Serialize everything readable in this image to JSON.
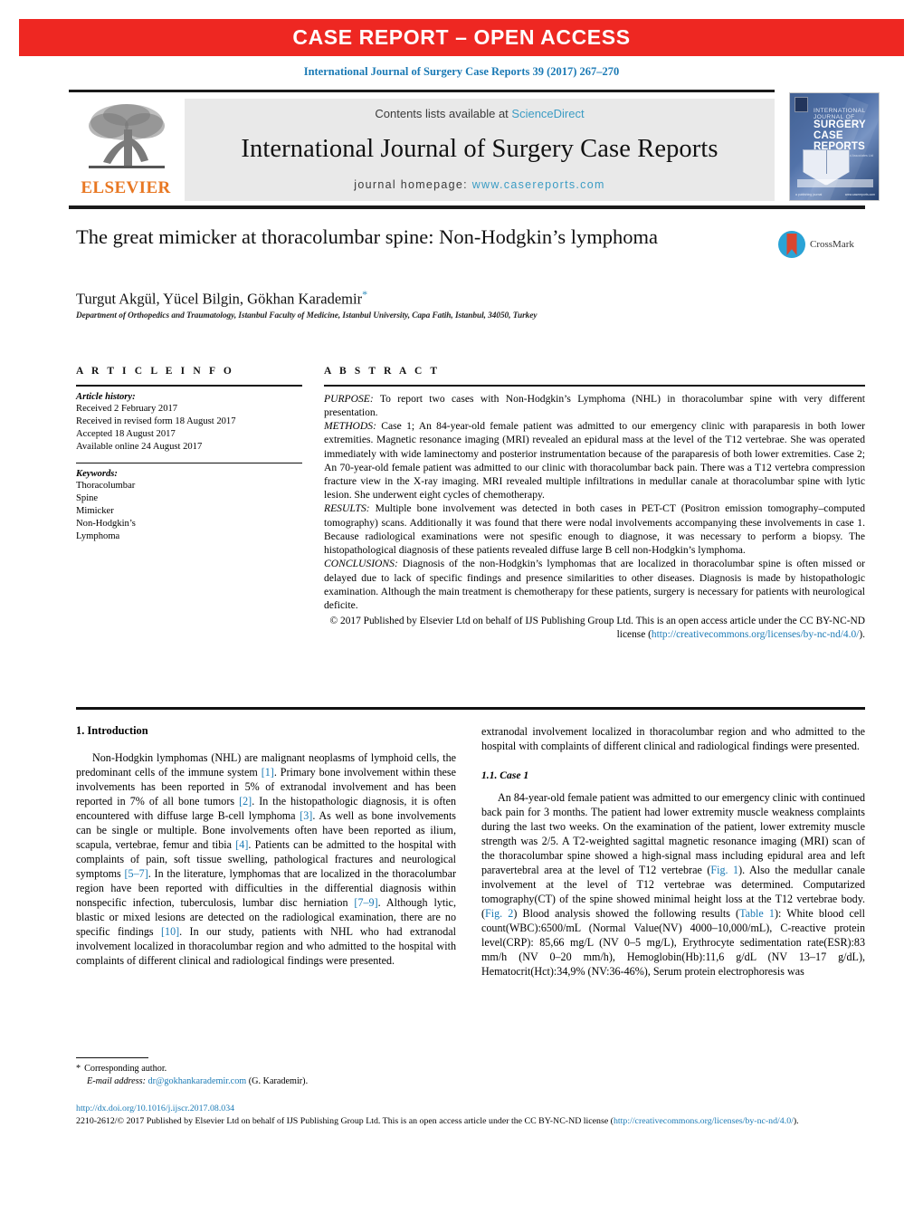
{
  "banner": {
    "text": "CASE REPORT – OPEN ACCESS",
    "color": "#ee2722"
  },
  "citation": "International Journal of Surgery Case Reports 39 (2017) 267–270",
  "journal_header": {
    "contents_prefix": "Contents lists available at ",
    "sciencedirect": "ScienceDirect",
    "journal_title": "International Journal of Surgery Case Reports",
    "homepage_label": "journal homepage: ",
    "homepage_url": "www.casereports.com",
    "publisher": "ELSEVIER",
    "cover": {
      "line1": "INTERNATIONAL",
      "line2": "JOURNAL OF",
      "line3": "SURGERY",
      "line4": "CASE",
      "line5": "REPORTS",
      "sub": "Official Journal of Surgical Associates Ltd",
      "foot_left": "a publishing journal",
      "foot_right": "www.casereports.com"
    }
  },
  "article": {
    "title": "The great mimicker at thoracolumbar spine: Non-Hodgkin’s lymphoma",
    "authors": "Turgut Akgül, Yücel Bilgin, Gökhan Karademir",
    "corresponding_marker": "*",
    "affiliation": "Department of Orthopedics and Traumatology, Istanbul Faculty of Medicine, Istanbul University, Capa Fatih, Istanbul, 34050, Turkey",
    "crossmark_label": "CrossMark"
  },
  "article_info": {
    "heading": "A R T I C L E  I N F O",
    "history_label": "Article history:",
    "history": [
      "Received 2 February 2017",
      "Received in revised form 18 August 2017",
      "Accepted 18 August 2017",
      "Available online 24 August 2017"
    ],
    "keywords_label": "Keywords:",
    "keywords": [
      "Thoracolumbar",
      "Spine",
      "Mimicker",
      "Non-Hodgkin’s",
      "Lymphoma"
    ]
  },
  "abstract": {
    "heading": "A B S T R A C T",
    "purpose_label": "PURPOSE:",
    "purpose": " To report two cases with Non-Hodgkin’s Lymphoma (NHL) in thoracolumbar spine with very different presentation.",
    "methods_label": "METHODS:",
    "methods": " Case 1; An 84-year-old female patient was admitted to our emergency clinic with paraparesis in both lower extremities. Magnetic resonance imaging (MRI) revealed an epidural mass at the level of the T12 vertebrae. She was operated immediately with wide laminectomy and posterior instrumentation because of the paraparesis of both lower extremities. Case 2; An 70-year-old female patient was admitted to our clinic with thoracolumbar back pain. There was a T12 vertebra compression fracture view in the X-ray imaging. MRI revealed multiple infiltrations in medullar canale at thoracolumbar spine with lytic lesion. She underwent eight cycles of chemotherapy.",
    "results_label": "RESULTS:",
    "results": " Multiple bone involvement was detected in both cases in PET-CT (Positron emission tomography–computed tomography) scans. Additionally it was found that there were nodal involvements accompanying these involvements in case 1. Because radiological examinations were not spesific enough to diagnose, it was necessary to perform a biopsy. The histopathological diagnosis of these patients revealed diffuse large B cell non-Hodgkin’s lymphoma.",
    "conclusions_label": "CONCLUSIONS:",
    "conclusions": " Diagnosis of the non-Hodgkin’s lymphomas that are localized in thoracolumbar spine is often missed or delayed due to lack of specific findings and presence similarities to other diseases. Diagnosis is made by histopathologic examination. Although the main treatment is chemotherapy for these patients, surgery is necessary for patients with neurological deficite.",
    "copyright_text": "© 2017 Published by Elsevier Ltd on behalf of IJS Publishing Group Ltd. This is an open access article under the CC BY-NC-ND license (",
    "copyright_link": "http://creativecommons.org/licenses/by-nc-nd/4.0/",
    "copyright_tail": ")."
  },
  "body": {
    "intro_heading": "1. Introduction",
    "intro_p1_a": "Non-Hodgkin lymphomas (NHL) are malignant neoplasms of lymphoid cells, the predominant cells of the immune system ",
    "intro_ref1": "[1]",
    "intro_p1_b": ". Primary bone involvement within these involvements has been reported in 5% of extranodal involvement and has been reported in 7% of all bone tumors ",
    "intro_ref2": "[2]",
    "intro_p1_c": ". In the histopathologic diagnosis, it is often encountered with diffuse large B-cell lymphoma ",
    "intro_ref3": "[3]",
    "intro_p1_d": ". As well as bone involvements can be single or multiple. Bone involvements often have been reported as ilium, scapula, vertebrae, femur and tibia ",
    "intro_ref4": "[4]",
    "intro_p1_e": ". Patients can be admitted to the hospital with complaints of pain, soft tissue swelling, pathological fractures and neurological symptoms ",
    "intro_ref5": "[5–7]",
    "intro_p1_f": ". In the literature, lymphomas that are localized in the thoracolumbar region have been reported with difficulties in the differential diagnosis within nonspecific infection, tuberculosis, lumbar disc herniation ",
    "intro_ref6": "[7–9]",
    "intro_p1_g": ". Although lytic, blastic or mixed lesions are detected on the radiological examination, there are no specific findings ",
    "intro_ref7": "[10]",
    "intro_p1_h": ". In our study, patients with NHL who had extranodal involvement localized in thoracolumbar region and who admitted to the hospital with complaints of different clinical and radiological findings were presented.",
    "case1_heading": "1.1. Case 1",
    "case1_a": "An 84-year-old female patient was admitted to our emergency clinic with continued back pain for 3 months. The patient had lower extremity muscle weakness complaints during the last two weeks. On the examination of the patient, lower extremity muscle strength was 2/5. A T2-weighted sagittal magnetic resonance imaging (MRI) scan of the thoracolumbar spine showed a high-signal mass including epidural area and left paravertebral area at the level of T12 vertebrae (",
    "case1_fig1": "Fig. 1",
    "case1_b": "). Also the medullar canale involvement at the level of T12 vertebrae was determined. Computarized tomography(CT) of the spine showed minimal height loss at the T12 vertebrae body. (",
    "case1_fig2": "Fig. 2",
    "case1_c": ") Blood analysis showed the following results (",
    "case1_table1": "Table 1",
    "case1_d": "): White blood cell count(WBC):6500/mL (Normal Value(NV) 4000–10,000/mL), C-reactive protein level(CRP): 85,66 mg/L (NV 0–5 mg/L), Erythrocyte sedimentation rate(ESR):83 mm/h (NV 0–20 mm/h), Hemoglobin(Hb):11,6 g/dL (NV 13–17 g/dL), Hematocrit(Hct):34,9% (NV:36-46%), Serum protein electrophoresis was"
  },
  "footnotes": {
    "corresponding_star": "*",
    "corresponding_label": "Corresponding author.",
    "email_label": "E-mail address:",
    "email": "dr@gokhankarademir.com",
    "email_suffix": "(G. Karademir).",
    "doi": "http://dx.doi.org/10.1016/j.ijscr.2017.08.034",
    "issn_line_a": "2210-2612/© 2017 Published by Elsevier Ltd on behalf of IJS Publishing Group Ltd. This is an open access article under the CC BY-NC-ND license (",
    "issn_link": "http://creativecommons.org/licenses/by-nc-nd/4.0/",
    "issn_line_b": ")."
  }
}
